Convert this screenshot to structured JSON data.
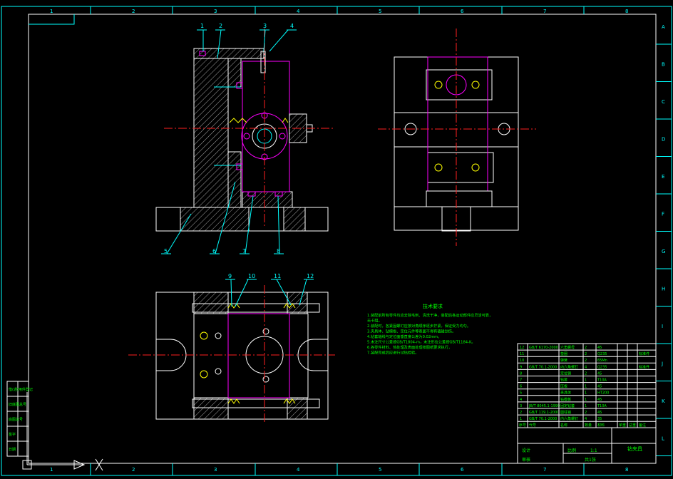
{
  "zone_columns": [
    "1",
    "2",
    "3",
    "4",
    "5",
    "6",
    "7",
    "8"
  ],
  "zone_rows": [
    "A",
    "B",
    "C",
    "D",
    "E",
    "F",
    "G",
    "H",
    "I",
    "J",
    "K",
    "L"
  ],
  "balloons_top": [
    "1",
    "2",
    "3",
    "4"
  ],
  "balloons_bottom": [
    "5",
    "6",
    "7",
    "8"
  ],
  "balloons_plan": [
    "9",
    "10",
    "11",
    "12"
  ],
  "notes": {
    "title": "技术要求",
    "lines": [
      "1.装配前所有零件均应去除毛刺、清洗干净，装配后各运动部件应灵活可靠，",
      "无卡阻。",
      "2.装配时，各紧固螺钉应按对角顺序逐步拧紧，保证受力均匀。",
      "3.夹具体、钻模板、定位元件等表面不得有磕碰划伤。",
      "4.钻套轴线与定位面垂直度公差为0.02mm。",
      "5.未注尺寸公差按GB/T1804-m，未注形位公差按GB/T1184-K。",
      "6.各零件材料、热处理及表面处理按图纸要求执行，",
      "7.装配完成后应进行试钻检验。"
    ]
  },
  "bom": [
    {
      "no": "12",
      "code": "GB/T 6170-2000",
      "name": "六角螺母",
      "qty": "2",
      "mat": "45",
      "note": ""
    },
    {
      "no": "11",
      "code": "",
      "name": "垫圈",
      "qty": "2",
      "mat": "Q235",
      "note": "",
      "green": "标准件"
    },
    {
      "no": "10",
      "code": "",
      "name": "弹簧",
      "qty": "2",
      "mat": "65Mn",
      "note": ""
    },
    {
      "no": "9",
      "code": "GB/T 70.1-2000",
      "name": "内六角螺钉",
      "qty": "4",
      "mat": "Q235",
      "note": "",
      "green": "标准件"
    },
    {
      "no": "8",
      "code": "",
      "name": "定位销",
      "qty": "2",
      "mat": "45",
      "note": ""
    },
    {
      "no": "7",
      "code": "",
      "name": "钻套",
      "qty": "1",
      "mat": "T10A",
      "note": ""
    },
    {
      "no": "6",
      "code": "",
      "name": "压板",
      "qty": "1",
      "mat": "45",
      "note": ""
    },
    {
      "no": "5",
      "code": "",
      "name": "夹具体",
      "qty": "1",
      "mat": "HT200",
      "note": ""
    },
    {
      "no": "4",
      "code": "",
      "name": "钻模板",
      "qty": "1",
      "mat": "45",
      "note": ""
    },
    {
      "no": "3",
      "code": "JB/T 8045.1-1999",
      "name": "固定钻套",
      "qty": "1",
      "mat": "T10A",
      "note": ""
    },
    {
      "no": "2",
      "code": "GB/T 119.1-2000",
      "name": "圆柱销",
      "qty": "2",
      "mat": "45",
      "note": ""
    },
    {
      "no": "1",
      "code": "GB/T 70.1-2000",
      "name": "内六角螺钉",
      "qty": "4",
      "mat": "35",
      "note": ""
    }
  ],
  "bom_header": [
    "序号",
    "代号",
    "名称",
    "数量",
    "材料",
    "单重",
    "总重",
    "备注"
  ],
  "title_block": {
    "drawing_name": "钻夹具",
    "scale_label": "比例",
    "scale": "1:1",
    "sheet": "共1张",
    "design": "设计",
    "check": "审核"
  },
  "left_strip": [
    "借(通)用件登记",
    "旧底图总号",
    "底图总号",
    "签字",
    "日期"
  ],
  "colors": {
    "border": "#ffffff",
    "frame_cyan": "#00ffff",
    "hatch": "#ffffff",
    "center": "#ff2020",
    "hidden": "#ff00ff",
    "text_green": "#00ff00",
    "bolt_yellow": "#ffff00"
  }
}
